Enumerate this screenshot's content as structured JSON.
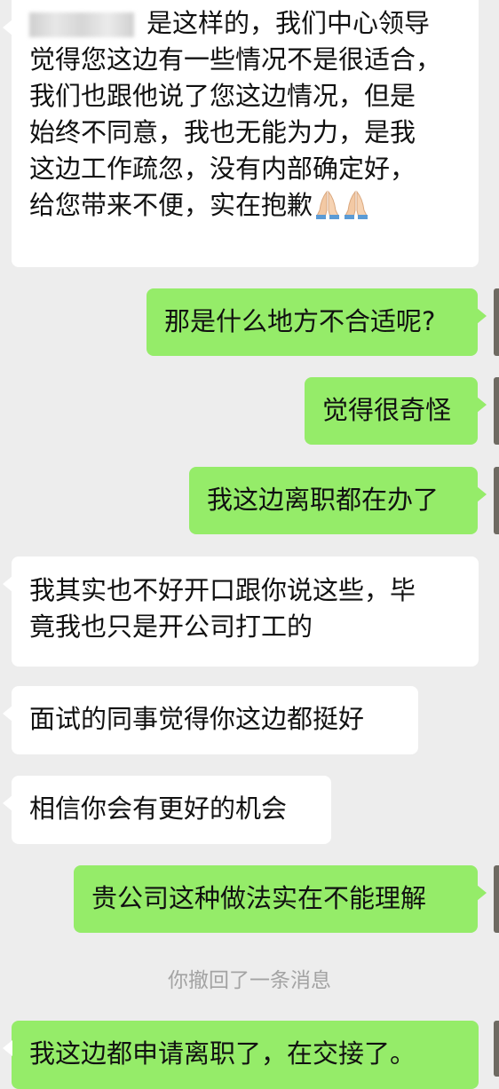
{
  "messages": [
    {
      "direction": "incoming",
      "lines": [
        "是这样的，我们中心领导",
        "觉得您这边有一些情况不是很适合，",
        "我们也跟他说了您这边情况，但是",
        "始终不同意，我也无能为力，是我",
        "这边工作疏忽，没有内部确定好，",
        "给您带来不便，实在抱歉"
      ],
      "emoji": [
        "folded-hands-icon",
        "folded-hands-icon"
      ]
    },
    {
      "direction": "outgoing",
      "text": "那是什么地方不合适呢?"
    },
    {
      "direction": "outgoing",
      "text": "觉得很奇怪"
    },
    {
      "direction": "outgoing",
      "text": "我这边离职都在办了"
    },
    {
      "direction": "incoming",
      "lines": [
        "我其实也不好开口跟你说这些，毕",
        "竟我也只是开公司打工的"
      ]
    },
    {
      "direction": "incoming",
      "text": "面试的同事觉得你这边都挺好"
    },
    {
      "direction": "incoming",
      "text": "相信你会有更好的机会"
    },
    {
      "direction": "outgoing",
      "text": "贵公司这种做法实在不能理解"
    },
    {
      "direction": "system",
      "text": "你撤回了一条消息"
    },
    {
      "direction": "incoming",
      "text": "我这边都申请离职了，在交接了。"
    }
  ],
  "colors": {
    "background": "#ededed",
    "incoming_bubble": "#ffffff",
    "outgoing_bubble": "#95ec69",
    "system_text": "#a3a3a3"
  }
}
